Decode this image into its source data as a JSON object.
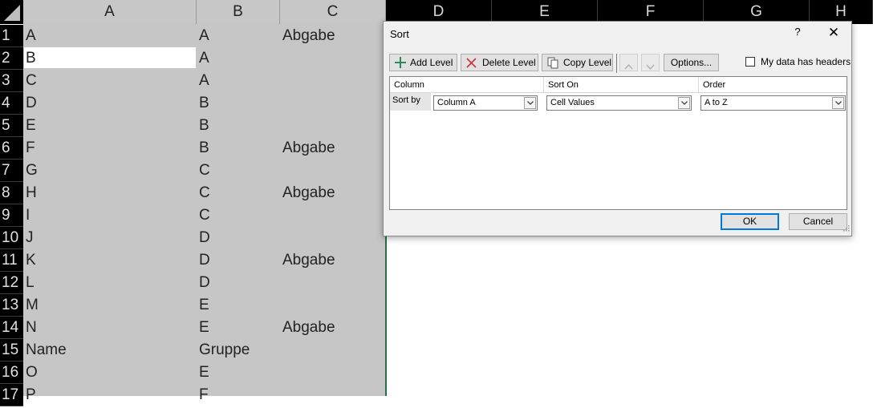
{
  "sheet": {
    "columns": [
      "A",
      "B",
      "C",
      "D",
      "E",
      "F",
      "G",
      "H"
    ],
    "rows": [
      {
        "num": "1",
        "a": "A",
        "b": "A",
        "c": "Abgabe"
      },
      {
        "num": "2",
        "a": "B",
        "b": "A",
        "c": ""
      },
      {
        "num": "3",
        "a": "C",
        "b": "A",
        "c": ""
      },
      {
        "num": "4",
        "a": "D",
        "b": "B",
        "c": ""
      },
      {
        "num": "5",
        "a": "E",
        "b": "B",
        "c": ""
      },
      {
        "num": "6",
        "a": "F",
        "b": "B",
        "c": "Abgabe"
      },
      {
        "num": "7",
        "a": "G",
        "b": "C",
        "c": ""
      },
      {
        "num": "8",
        "a": "H",
        "b": "C",
        "c": "Abgabe"
      },
      {
        "num": "9",
        "a": "I",
        "b": "C",
        "c": ""
      },
      {
        "num": "10",
        "a": "J",
        "b": "D",
        "c": ""
      },
      {
        "num": "11",
        "a": "K",
        "b": "D",
        "c": "Abgabe"
      },
      {
        "num": "12",
        "a": "L",
        "b": "D",
        "c": ""
      },
      {
        "num": "13",
        "a": "M",
        "b": "E",
        "c": ""
      },
      {
        "num": "14",
        "a": "N",
        "b": "E",
        "c": "Abgabe"
      },
      {
        "num": "15",
        "a": "Name",
        "b": "Gruppe",
        "c": ""
      },
      {
        "num": "16",
        "a": "O",
        "b": "E",
        "c": ""
      },
      {
        "num": "17",
        "a": "P",
        "b": "F",
        "c": ""
      }
    ]
  },
  "dialog": {
    "title": "Sort",
    "help": "?",
    "close": "✕",
    "toolbar": {
      "add_level": "Add Level",
      "delete_level": "Delete Level",
      "copy_level": "Copy Level",
      "options": "Options..."
    },
    "headers_checkbox": {
      "label": "My data has headers",
      "checked": false
    },
    "grid": {
      "headers": {
        "column": "Column",
        "sort_on": "Sort On",
        "order": "Order"
      },
      "sort_by_label": "Sort by",
      "column_value": "Column A",
      "sort_on_value": "Cell Values",
      "order_value": "A to Z"
    },
    "ok": "OK",
    "cancel": "Cancel"
  },
  "colors": {
    "selection_gray": "#c6c6c6",
    "excel_green": "#217346",
    "focus_blue": "#0078d7"
  }
}
